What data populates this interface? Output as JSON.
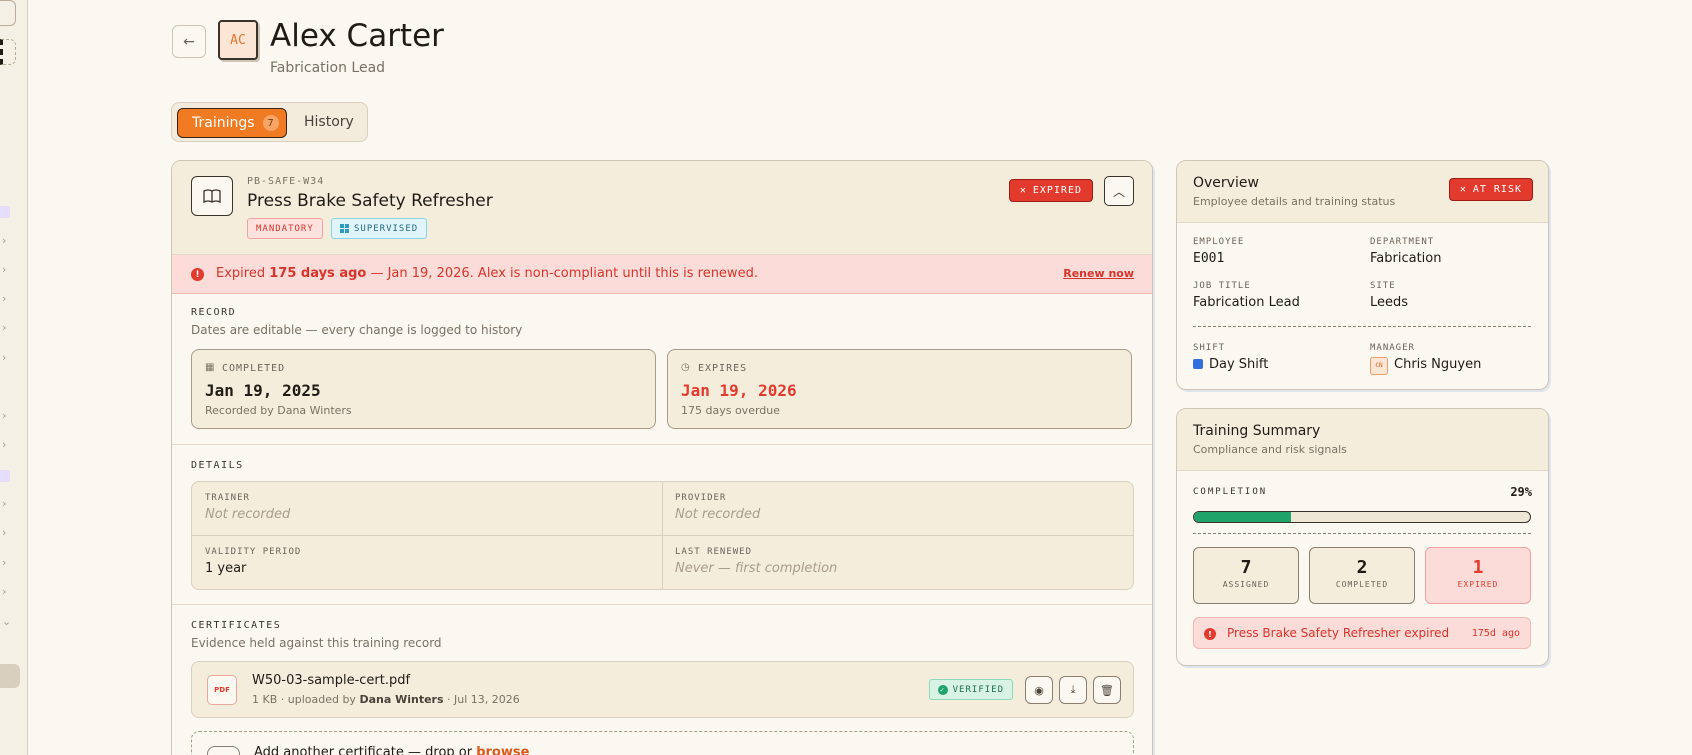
{
  "header": {
    "avatar_initials": "AC",
    "name": "Alex Carter",
    "role": "Fabrication Lead",
    "back_icon": "arrow-left-icon"
  },
  "tabs": [
    {
      "label": "Trainings",
      "count": "7",
      "active": true
    },
    {
      "label": "History",
      "active": false
    }
  ],
  "training": {
    "code": "PB-SAFE-W34",
    "title": "Press Brake Safety Refresher",
    "tags": [
      "MANDATORY",
      "SUPERVISED"
    ],
    "status": "EXPIRED",
    "alert": {
      "prefix": "Expired",
      "days": "175 days ago",
      "rest": " — Jan 19, 2026. Alex is non-compliant until this is renewed.",
      "action": "Renew now"
    },
    "record": {
      "label": "RECORD",
      "sub": "Dates are editable — every change is logged to history",
      "completed_label": "COMPLETED",
      "completed_value": "Jan 19, 2025",
      "completed_note": "Recorded by Dana Winters",
      "expires_label": "EXPIRES",
      "expires_value": "Jan 19, 2026",
      "expires_note": "175 days overdue"
    },
    "details": {
      "label": "DETAILS",
      "trainer_label": "TRAINER",
      "trainer_value": "Not recorded",
      "provider_label": "PROVIDER",
      "provider_value": "Not recorded",
      "validity_label": "VALIDITY PERIOD",
      "validity_value": "1 year",
      "renewed_label": "LAST RENEWED",
      "renewed_value": "Never — first completion"
    },
    "certificates": {
      "label": "CERTIFICATES",
      "sub": "Evidence held against this training record",
      "file_name": "W50-03-sample-cert.pdf",
      "file_type": "PDF",
      "meta_size": "1 KB · uploaded by ",
      "meta_user": "Dana Winters",
      "meta_date": " · Jul 13, 2026",
      "badge": "VERIFIED",
      "add_text": "Add another certificate — drop or ",
      "add_link": "browse"
    }
  },
  "overview": {
    "title": "Overview",
    "sub": "Employee details and training status",
    "status": "AT RISK",
    "employee_label": "EMPLOYEE",
    "employee_value": "E001",
    "department_label": "DEPARTMENT",
    "department_value": "Fabrication",
    "job_label": "JOB TITLE",
    "job_value": "Fabrication Lead",
    "site_label": "SITE",
    "site_value": "Leeds",
    "shift_label": "SHIFT",
    "shift_value": "Day Shift",
    "shift_color": "#2f6fe0",
    "manager_label": "MANAGER",
    "manager_initials": "CN",
    "manager_value": "Chris Nguyen"
  },
  "summary": {
    "title": "Training Summary",
    "sub": "Compliance and risk signals",
    "completion_label": "COMPLETION",
    "completion_value": "29%",
    "completion_fraction": 0.29,
    "assigned": "7",
    "assigned_label": "ASSIGNED",
    "completed": "2",
    "completed_label": "COMPLETED",
    "expired": "1",
    "expired_label": "EXPIRED",
    "alert_text": "Press Brake Safety Refresher expired",
    "alert_ago": "175d ago"
  },
  "colors": {
    "accent": "#f07b22",
    "danger": "#e23a2c",
    "success": "#1fa36b"
  }
}
